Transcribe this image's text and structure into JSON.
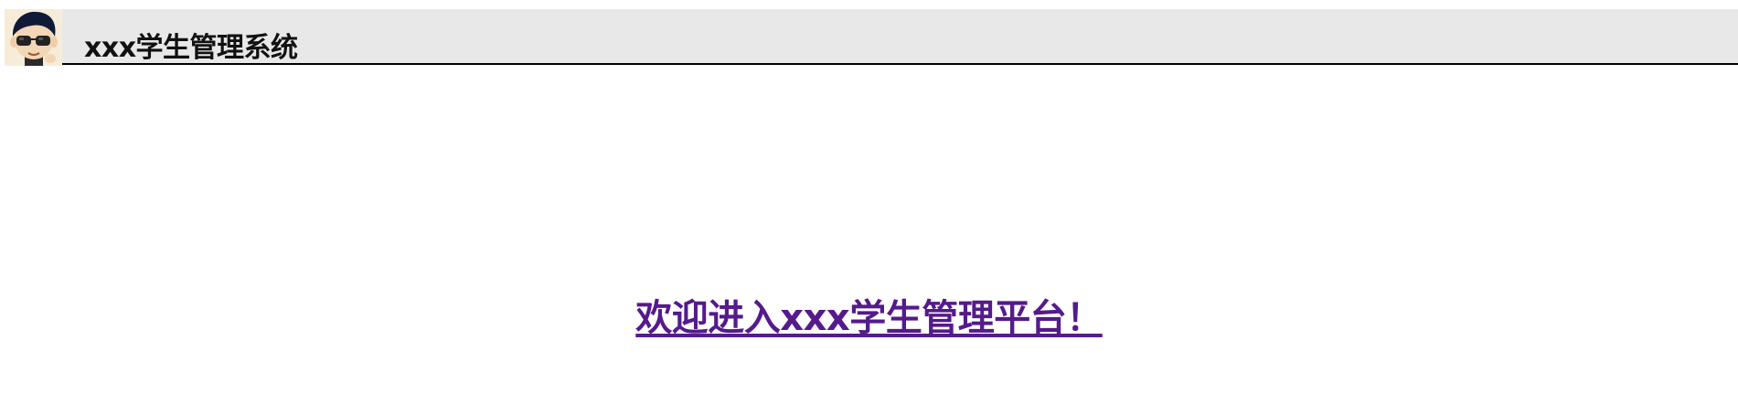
{
  "header": {
    "avatar_icon": "cartoon-avatar-with-sunglasses-icon",
    "title": "xxx学生管理系统",
    "background_color": "#e8e8e8",
    "border_color": "#000000"
  },
  "main": {
    "welcome_link": "欢迎进入xxx学生管理平台！",
    "welcome_link_color": "#551a8b"
  }
}
